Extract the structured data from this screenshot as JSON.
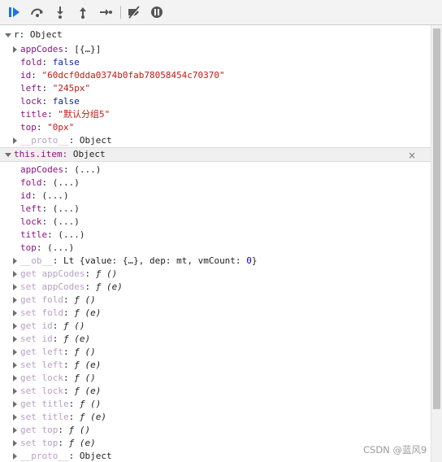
{
  "toolbar": {
    "buttons": [
      {
        "name": "resume-icon"
      },
      {
        "name": "step-over-icon"
      },
      {
        "name": "step-into-icon"
      },
      {
        "name": "step-out-icon"
      },
      {
        "name": "step-icon"
      },
      {
        "name": "deactivate-breakpoints-icon"
      },
      {
        "name": "pause-on-exceptions-icon"
      }
    ]
  },
  "r": {
    "header": "r:",
    "header_type": "Object",
    "props": [
      {
        "key": "appCodes",
        "value": "[{…}]"
      },
      {
        "key": "fold",
        "value": "false"
      },
      {
        "key": "id",
        "value": "\"60dcf0dda0374b0fab78058454c70370\""
      },
      {
        "key": "left",
        "value": "\"245px\""
      },
      {
        "key": "lock",
        "value": "false"
      },
      {
        "key": "title",
        "value": "\"默认分组5\""
      },
      {
        "key": "top",
        "value": "\"0px\""
      },
      {
        "key": "__proto__",
        "value": "Object"
      }
    ]
  },
  "item": {
    "header": "this.item:",
    "header_type": "Object",
    "close": "×",
    "props": [
      {
        "key": "appCodes",
        "value": "(...)"
      },
      {
        "key": "fold",
        "value": "(...)"
      },
      {
        "key": "id",
        "value": "(...)"
      },
      {
        "key": "left",
        "value": "(...)"
      },
      {
        "key": "lock",
        "value": "(...)"
      },
      {
        "key": "title",
        "value": "(...)"
      },
      {
        "key": "top",
        "value": "(...)"
      }
    ],
    "ob": {
      "key": "__ob__",
      "prefix": "Lt {value: {…}, dep: ",
      "dep": "mt",
      "mid": ", vmCount: ",
      "count": "0",
      "end": "}"
    },
    "accessors": [
      {
        "key": "get appCodes",
        "value": "ƒ ()"
      },
      {
        "key": "set appCodes",
        "value": "ƒ (e)"
      },
      {
        "key": "get fold",
        "value": "ƒ ()"
      },
      {
        "key": "set fold",
        "value": "ƒ (e)"
      },
      {
        "key": "get id",
        "value": "ƒ ()"
      },
      {
        "key": "set id",
        "value": "ƒ (e)"
      },
      {
        "key": "get left",
        "value": "ƒ ()"
      },
      {
        "key": "set left",
        "value": "ƒ (e)"
      },
      {
        "key": "get lock",
        "value": "ƒ ()"
      },
      {
        "key": "set lock",
        "value": "ƒ (e)"
      },
      {
        "key": "get title",
        "value": "ƒ ()"
      },
      {
        "key": "set title",
        "value": "ƒ (e)"
      },
      {
        "key": "get top",
        "value": "ƒ ()"
      },
      {
        "key": "set top",
        "value": "ƒ (e)"
      }
    ],
    "proto": {
      "key": "__proto__",
      "value": "Object"
    }
  },
  "watermark": "CSDN @蓝风9"
}
